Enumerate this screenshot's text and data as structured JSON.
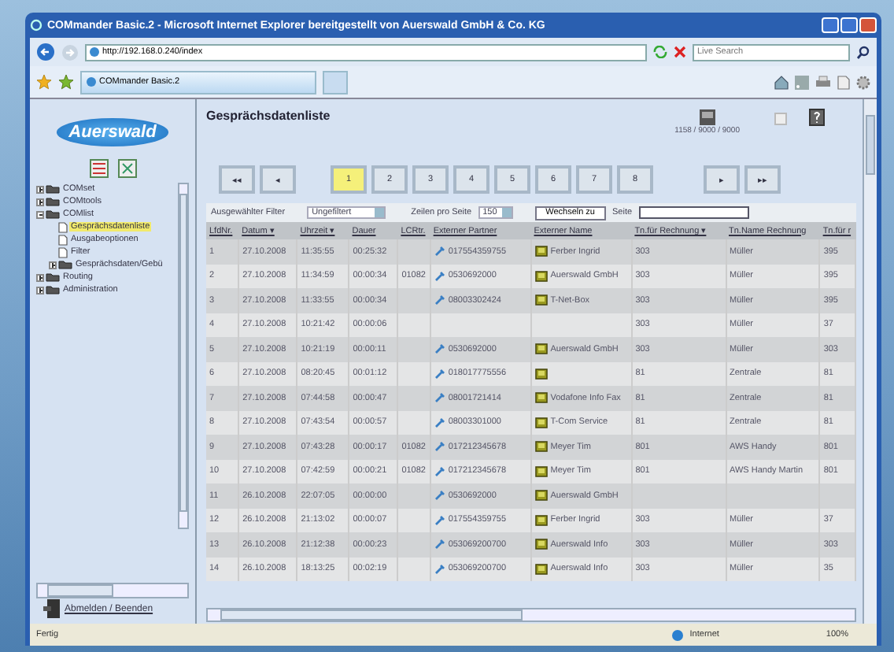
{
  "window": {
    "title": "COMmander Basic.2 - Microsoft Internet Explorer bereitgestellt von Auerswald GmbH & Co. KG"
  },
  "browser": {
    "address": "http://192.168.0.240/index",
    "search_placeholder": "Live Search",
    "tab": "COMmander Basic.2"
  },
  "sidebar": {
    "logo": "Auerswald",
    "tree": [
      {
        "label": "COMset",
        "kind": "folder",
        "expanded": false,
        "selected": false
      },
      {
        "label": "COMtools",
        "kind": "folder",
        "expanded": false,
        "selected": false
      },
      {
        "label": "COMlist",
        "kind": "folder",
        "expanded": true,
        "selected": false,
        "children": [
          {
            "label": "Gesprächsdatenliste",
            "kind": "page",
            "selected": true
          },
          {
            "label": "Ausgabeoptionen",
            "kind": "page",
            "selected": false
          },
          {
            "label": "Filter",
            "kind": "page",
            "selected": false
          },
          {
            "label": "Gesprächsdaten/Gebü",
            "kind": "folder",
            "expanded": false,
            "selected": false
          }
        ]
      },
      {
        "label": "Routing",
        "kind": "folder",
        "expanded": false,
        "selected": false
      },
      {
        "label": "Administration",
        "kind": "folder",
        "expanded": false,
        "selected": false
      }
    ],
    "logout": "Abmelden / Beenden"
  },
  "page": {
    "title": "Gesprächsdatenliste",
    "counter": "1158 / 9000 / 9000",
    "pager": {
      "first": "◂◂",
      "prev": "◂",
      "next": "▸",
      "last": "▸▸",
      "pages": [
        {
          "label": "1",
          "selected": true
        },
        {
          "label": "2",
          "selected": false
        },
        {
          "label": "3",
          "selected": false
        },
        {
          "label": "4",
          "selected": false
        },
        {
          "label": "5",
          "selected": false
        },
        {
          "label": "6",
          "selected": false
        },
        {
          "label": "7",
          "selected": false
        },
        {
          "label": "8",
          "selected": false
        }
      ]
    },
    "filter_label": "Ausgewählter Filter",
    "filter_value": "Ungefiltert",
    "rows_label": "Zeilen pro Seite",
    "rows_value": "150",
    "goto_button": "Wechseln zu",
    "page_label": "Seite"
  },
  "table": {
    "columns": [
      "LfdNr.",
      "Datum ▾",
      "Uhrzeit ▾",
      "Dauer",
      "LCRtr.",
      "Externer Partner",
      "Externer Name",
      "Tn.für Rechnung ▾",
      "Tn.Name Rechnung",
      "Tn.für r"
    ],
    "rows": [
      [
        "1",
        "27.10.2008",
        "11:35:55",
        "00:25:32",
        "",
        "017554359755",
        "Ferber Ingrid",
        "303",
        "Müller",
        "395"
      ],
      [
        "2",
        "27.10.2008",
        "11:34:59",
        "00:00:34",
        "01082",
        "0530692000",
        "Auerswald GmbH",
        "303",
        "Müller",
        "395"
      ],
      [
        "3",
        "27.10.2008",
        "11:33:55",
        "00:00:34",
        "",
        "08003302424",
        "T-Net-Box",
        "303",
        "Müller",
        "395"
      ],
      [
        "4",
        "27.10.2008",
        "10:21:42",
        "00:00:06",
        "",
        "",
        "",
        "303",
        "Müller",
        "37"
      ],
      [
        "5",
        "27.10.2008",
        "10:21:19",
        "00:00:11",
        "",
        "0530692000",
        "Auerswald GmbH",
        "303",
        "Müller",
        "303"
      ],
      [
        "6",
        "27.10.2008",
        "08:20:45",
        "00:01:12",
        "",
        "018017775556",
        "",
        "81",
        "Zentrale",
        "81"
      ],
      [
        "7",
        "27.10.2008",
        "07:44:58",
        "00:00:47",
        "",
        "08001721414",
        "Vodafone Info Fax",
        "81",
        "Zentrale",
        "81"
      ],
      [
        "8",
        "27.10.2008",
        "07:43:54",
        "00:00:57",
        "",
        "08003301000",
        "T-Com Service",
        "81",
        "Zentrale",
        "81"
      ],
      [
        "9",
        "27.10.2008",
        "07:43:28",
        "00:00:17",
        "01082",
        "017212345678",
        "Meyer Tim",
        "801",
        "AWS Handy",
        "801"
      ],
      [
        "10",
        "27.10.2008",
        "07:42:59",
        "00:00:21",
        "01082",
        "017212345678",
        "Meyer Tim",
        "801",
        "AWS Handy Martin",
        "801"
      ],
      [
        "11",
        "26.10.2008",
        "22:07:05",
        "00:00:00",
        "",
        "0530692000",
        "Auerswald GmbH",
        "",
        "",
        ""
      ],
      [
        "12",
        "26.10.2008",
        "21:13:02",
        "00:00:07",
        "",
        "017554359755",
        "Ferber Ingrid",
        "303",
        "Müller",
        "37"
      ],
      [
        "13",
        "26.10.2008",
        "21:12:38",
        "00:00:23",
        "",
        "053069200700",
        "Auerswald Info",
        "303",
        "Müller",
        "303"
      ],
      [
        "14",
        "26.10.2008",
        "18:13:25",
        "00:02:19",
        "",
        "053069200700",
        "Auerswald Info",
        "303",
        "Müller",
        "35"
      ]
    ]
  },
  "status_bar": {
    "text": "Fertig",
    "zone": "Internet",
    "zoom": "100%"
  }
}
